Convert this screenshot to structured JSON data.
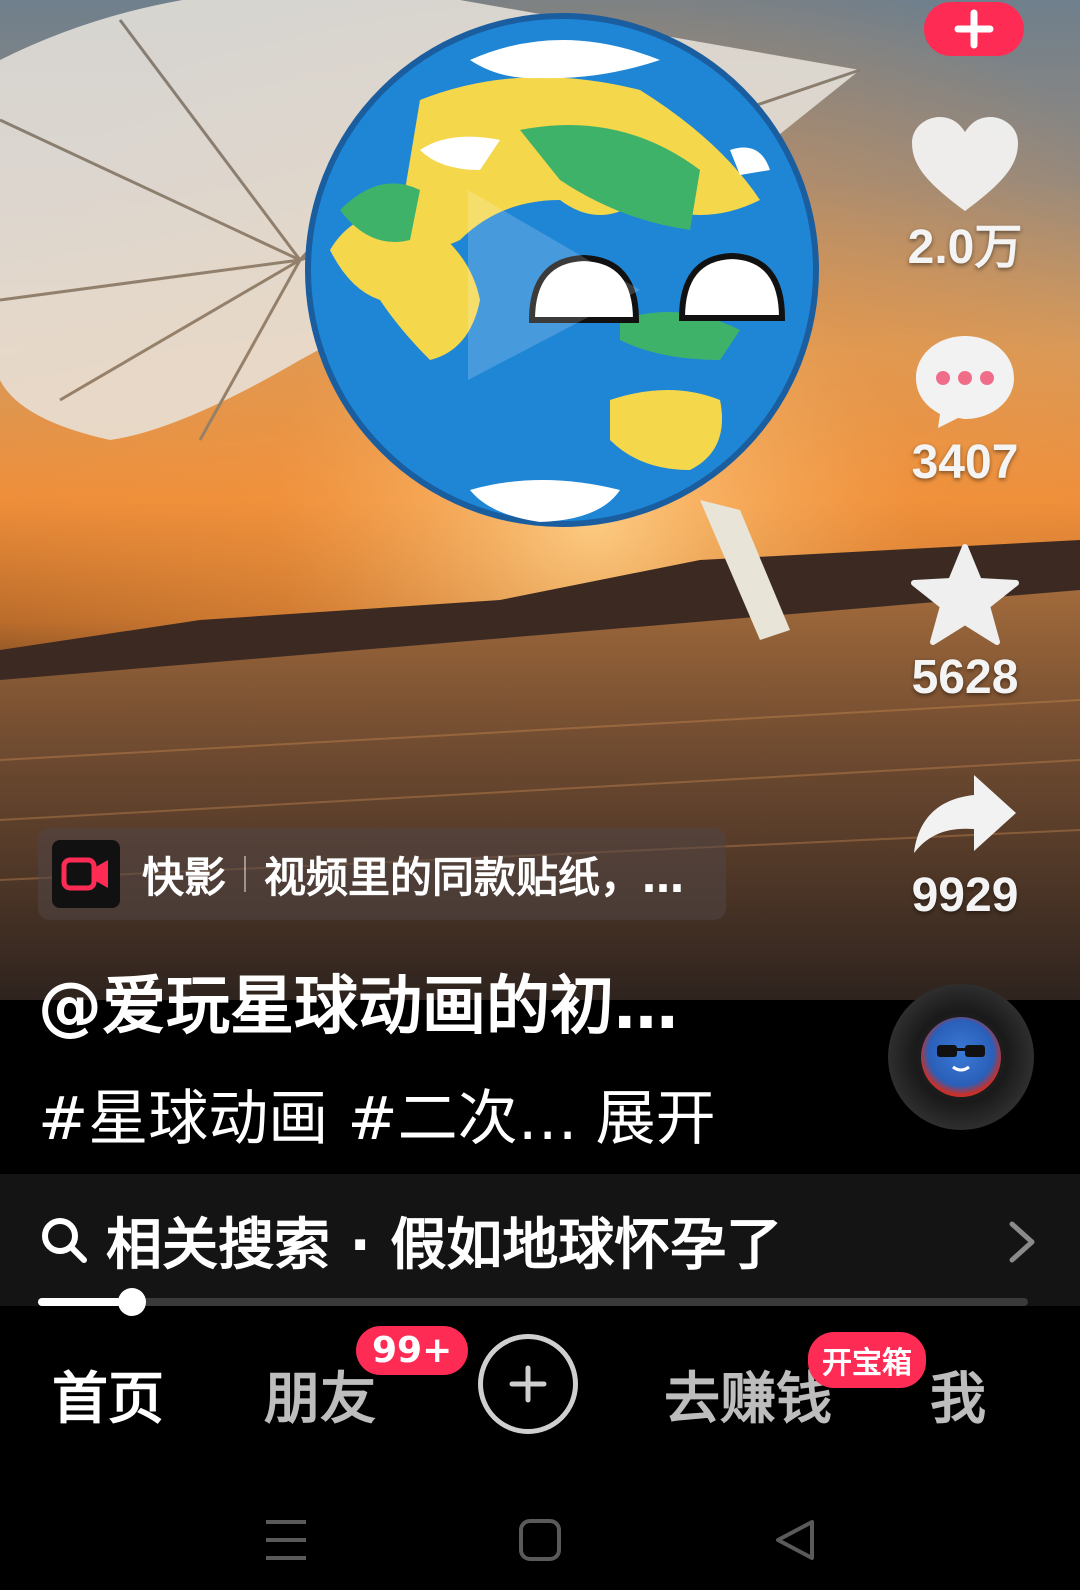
{
  "actions": {
    "like_count": "2.0万",
    "comment_count": "3407",
    "favorite_count": "5628",
    "share_count": "9929"
  },
  "sticker": {
    "app_name": "快影",
    "text": "视频里的同款贴纸，…"
  },
  "caption": {
    "author": "@爱玩星球动画的初…",
    "hashtags": "#星球动画 #二次…",
    "expand_label": "展开"
  },
  "related_search": {
    "text": "相关搜索 · 假如地球怀孕了"
  },
  "progress": {
    "played_fraction": 0.095
  },
  "tabbar": {
    "home": "首页",
    "friends": "朋友",
    "friends_badge": "99+",
    "earn": "去赚钱",
    "earn_badge": "开宝箱",
    "me": "我"
  },
  "icons": {
    "follow": "plus-icon",
    "like": "heart-icon",
    "comment": "comment-bubble-icon",
    "favorite": "star-icon",
    "share": "share-arrow-icon",
    "search": "search-icon",
    "chevron": "chevron-right-icon",
    "add": "add-icon",
    "menu": "menu-icon",
    "home_sys": "home-square-icon",
    "back": "back-triangle-icon"
  },
  "colors": {
    "accent": "#fe2c55"
  }
}
